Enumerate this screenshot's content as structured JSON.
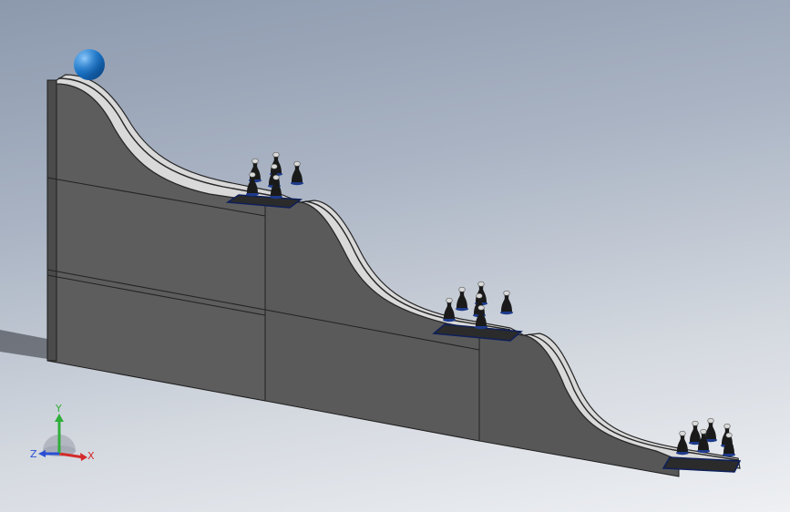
{
  "viewport": {
    "description_colors": {
      "background_top": "#8c99ad",
      "background_bottom": "#eef0f3",
      "wall": "#5b5b5b",
      "track": "#d8d8d8",
      "ball": "#1670c4",
      "pin": "#1a1a1a",
      "pin_base": "#1d3a8a"
    }
  },
  "model": {
    "ball_count": 1,
    "pin_groups": [
      {
        "pins": 6
      },
      {
        "pins": 6
      },
      {
        "pins": 6
      }
    ]
  },
  "triad": {
    "x_label": "X",
    "y_label": "Y",
    "z_label": "Z",
    "colors": {
      "x": "#d42a2a",
      "y": "#2fae3a",
      "z": "#2a4fd4"
    }
  }
}
